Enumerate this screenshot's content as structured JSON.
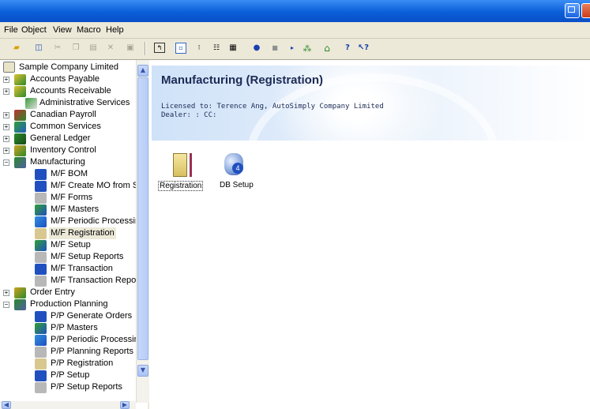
{
  "menu": [
    "File",
    "Object",
    "View",
    "Macro",
    "Help"
  ],
  "toolbar_icons": [
    "open-folder-icon",
    "book-icon",
    "cut-icon",
    "copy-icon",
    "paste-icon",
    "delete-icon",
    "properties-icon",
    "up-folder-icon",
    "large-icons-view-icon",
    "small-icons-view-icon",
    "list-view-icon",
    "details-view-icon",
    "dot-icon",
    "square-icon",
    "arrow-icon",
    "tree-icon",
    "home-icon",
    "help-icon",
    "whats-this-help-icon"
  ],
  "tree": {
    "root": "Sample Company Limited",
    "items": [
      {
        "label": "Accounts Payable"
      },
      {
        "label": "Accounts Receivable"
      },
      {
        "label": "Administrative Services"
      },
      {
        "label": "Canadian Payroll"
      },
      {
        "label": "Common Services"
      },
      {
        "label": "General Ledger"
      },
      {
        "label": "Inventory Control"
      },
      {
        "label": "Manufacturing"
      },
      {
        "label": "M/F BOM"
      },
      {
        "label": "M/F Create MO from SC"
      },
      {
        "label": "M/F Forms"
      },
      {
        "label": "M/F Masters"
      },
      {
        "label": "M/F Periodic Processing"
      },
      {
        "label": "M/F Registration"
      },
      {
        "label": "M/F Setup"
      },
      {
        "label": "M/F Setup Reports"
      },
      {
        "label": "M/F Transaction"
      },
      {
        "label": "M/F Transaction Report"
      },
      {
        "label": "Order Entry"
      },
      {
        "label": "Production Planning"
      },
      {
        "label": "P/P Generate Orders"
      },
      {
        "label": "P/P Masters"
      },
      {
        "label": "P/P Periodic Processing"
      },
      {
        "label": "P/P Planning Reports"
      },
      {
        "label": "P/P Registration"
      },
      {
        "label": "P/P Setup"
      },
      {
        "label": "P/P Setup Reports"
      }
    ]
  },
  "content": {
    "title": "Manufacturing (Registration)",
    "licensed": "Licensed to: Terence Ang, AutoSimply Company Limited",
    "dealer": "Dealer: : CC:",
    "icons": [
      {
        "label": "Registration"
      },
      {
        "label": "DB Setup"
      }
    ]
  }
}
